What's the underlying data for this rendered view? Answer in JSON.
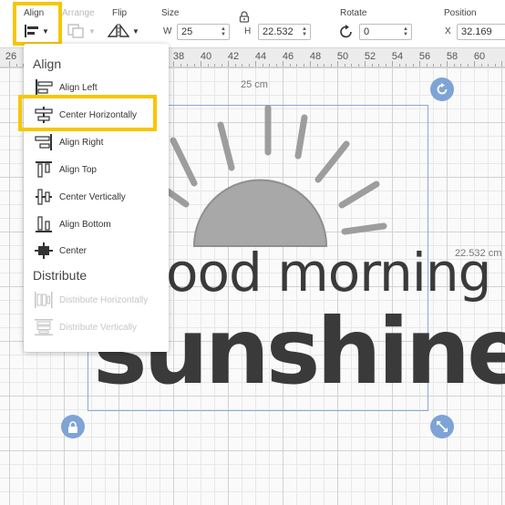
{
  "toolbar": {
    "align_label": "Align",
    "arrange_label": "Arrange",
    "flip_label": "Flip",
    "size_label": "Size",
    "rotate_label": "Rotate",
    "position_label": "Position",
    "width_prefix": "W",
    "width_value": "25",
    "height_prefix": "H",
    "height_value": "22.532",
    "rotate_value": "0",
    "x_prefix": "X",
    "x_value": "32.169"
  },
  "ruler": {
    "numbers": [
      "26",
      "38",
      "40",
      "42",
      "44",
      "46",
      "48",
      "50",
      "52",
      "54",
      "56",
      "58",
      "60"
    ]
  },
  "canvas": {
    "width_dimension": "25 cm",
    "height_dimension": "22.532 cm"
  },
  "artwork": {
    "line1": "ood morning",
    "line2": "sunshine"
  },
  "menu": {
    "align_heading": "Align",
    "distribute_heading": "Distribute",
    "items": [
      {
        "label": "Align Left",
        "icon": "align-left-icon"
      },
      {
        "label": "Center Horizontally",
        "icon": "center-horizontally-icon"
      },
      {
        "label": "Align Right",
        "icon": "align-right-icon"
      },
      {
        "label": "Align Top",
        "icon": "align-top-icon"
      },
      {
        "label": "Center Vertically",
        "icon": "center-vertically-icon"
      },
      {
        "label": "Align Bottom",
        "icon": "align-bottom-icon"
      },
      {
        "label": "Center",
        "icon": "center-icon"
      }
    ],
    "distribute_items": [
      {
        "label": "Distribute Horizontally",
        "icon": "distribute-horizontally-icon"
      },
      {
        "label": "Distribute Vertically",
        "icon": "distribute-vertically-icon"
      }
    ]
  },
  "colors": {
    "highlight": "#f7c600",
    "handle": "#7ea3d6",
    "artwork": "#3a3a3a",
    "sun": "#a8a8a8"
  }
}
